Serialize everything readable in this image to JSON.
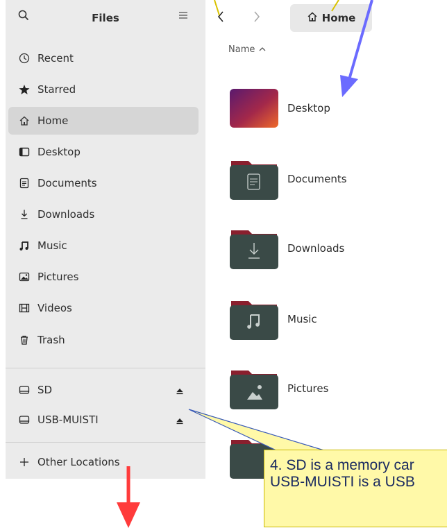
{
  "sidebar": {
    "title": "Files",
    "items": [
      {
        "label": "Recent",
        "icon": "clock-icon"
      },
      {
        "label": "Starred",
        "icon": "star-icon"
      },
      {
        "label": "Home",
        "icon": "home-icon",
        "active": true
      },
      {
        "label": "Desktop",
        "icon": "desktop-icon"
      },
      {
        "label": "Documents",
        "icon": "document-icon"
      },
      {
        "label": "Downloads",
        "icon": "download-icon"
      },
      {
        "label": "Music",
        "icon": "music-icon"
      },
      {
        "label": "Pictures",
        "icon": "picture-icon"
      },
      {
        "label": "Videos",
        "icon": "film-icon"
      },
      {
        "label": "Trash",
        "icon": "trash-icon"
      }
    ],
    "devices": [
      {
        "label": "SD",
        "icon": "drive-icon"
      },
      {
        "label": "USB-MUISTI",
        "icon": "drive-icon"
      }
    ],
    "other_locations": "Other Locations"
  },
  "toolbar": {
    "path_label": "Home"
  },
  "list": {
    "sort_header": "Name",
    "files": [
      "Desktop",
      "Documents",
      "Downloads",
      "Music",
      "Pictures"
    ]
  },
  "annotation": {
    "line1": "4. SD is a memory car",
    "line2": "USB-MUISTI is a USB"
  },
  "colors": {
    "annotation_blue": "#6b6bff",
    "annotation_red": "#ff3b3b",
    "folder_dark": "#3a4a47",
    "folder_tab": "#8a1f2e"
  }
}
